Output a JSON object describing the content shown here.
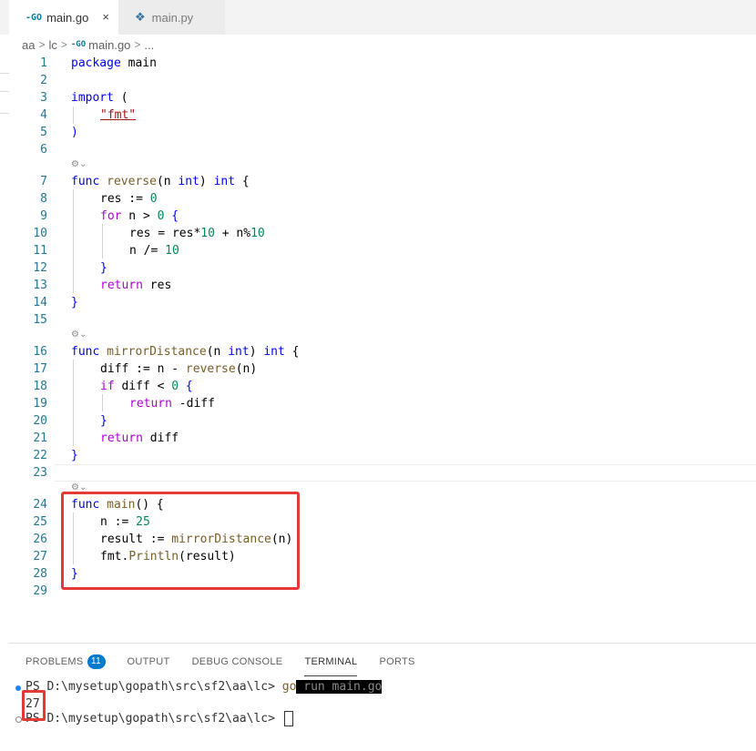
{
  "tabs": [
    {
      "icon": "-GO",
      "label": "main.go",
      "close": "×"
    },
    {
      "icon": "❖",
      "label": "main.py"
    }
  ],
  "breadcrumb": {
    "parts": [
      "aa",
      "lc",
      "main.go",
      "..."
    ],
    "sep": ">",
    "go_icon": "-GO"
  },
  "editor": {
    "lens_glyph": "⚙︎⌄",
    "line_numbers": [
      "1",
      "2",
      "3",
      "4",
      "5",
      "6",
      "7",
      "8",
      "9",
      "10",
      "11",
      "12",
      "13",
      "14",
      "15",
      "16",
      "17",
      "18",
      "19",
      "20",
      "21",
      "22",
      "23",
      "24",
      "25",
      "26",
      "27",
      "28",
      "29"
    ]
  },
  "code": {
    "l1": {
      "kw": "package",
      "rest": " main"
    },
    "l3": {
      "kw": "import",
      "rest": " ("
    },
    "l4": {
      "str": "\"fmt\""
    },
    "l5": {
      "rest": ")"
    },
    "l7": {
      "kw": "func",
      "fn": "reverse",
      "p1": "(n ",
      "ty": "int",
      "p2": ") ",
      "ty2": "int",
      "p3": " {"
    },
    "l8": {
      "a": "res := ",
      "num": "0"
    },
    "l9": {
      "ctl": "for",
      "a": " n > ",
      "num": "0",
      "b": " {"
    },
    "l10": {
      "a": "res = res*",
      "num": "10",
      "b": " + n%",
      "num2": "10"
    },
    "l11": {
      "a": "n /= ",
      "num": "10"
    },
    "l12": {
      "a": "}"
    },
    "l13": {
      "ctl": "return",
      "a": " res"
    },
    "l14": {
      "a": "}"
    },
    "l16": {
      "kw": "func",
      "fn": "mirrorDistance",
      "p1": "(n ",
      "ty": "int",
      "p2": ") ",
      "ty2": "int",
      "p3": " {"
    },
    "l17": {
      "a": "diff := n - ",
      "fn": "reverse",
      "b": "(n)"
    },
    "l18": {
      "ctl": "if",
      "a": " diff < ",
      "num": "0",
      "b": " {"
    },
    "l19": {
      "ctl": "return",
      "a": " -diff"
    },
    "l20": {
      "a": "}"
    },
    "l21": {
      "ctl": "return",
      "a": " diff"
    },
    "l22": {
      "a": "}"
    },
    "l24": {
      "kw": "func",
      "fn": "main",
      "a": "() {"
    },
    "l25": {
      "a": "n := ",
      "num": "25"
    },
    "l26": {
      "a": "result := ",
      "fn": "mirrorDistance",
      "b": "(n)"
    },
    "l27": {
      "a": "fmt.",
      "fn": "Println",
      "b": "(result)"
    },
    "l28": {
      "a": "}"
    }
  },
  "panel": {
    "tabs": [
      "PROBLEMS",
      "OUTPUT",
      "DEBUG CONSOLE",
      "TERMINAL",
      "PORTS"
    ],
    "problems_count": "11"
  },
  "terminal": {
    "prompt": "PS D:\\mysetup\\gopath\\src\\sf2\\aa\\lc> ",
    "cmd_go": "go",
    "cmd_rest": " run main.go",
    "output": "27"
  }
}
